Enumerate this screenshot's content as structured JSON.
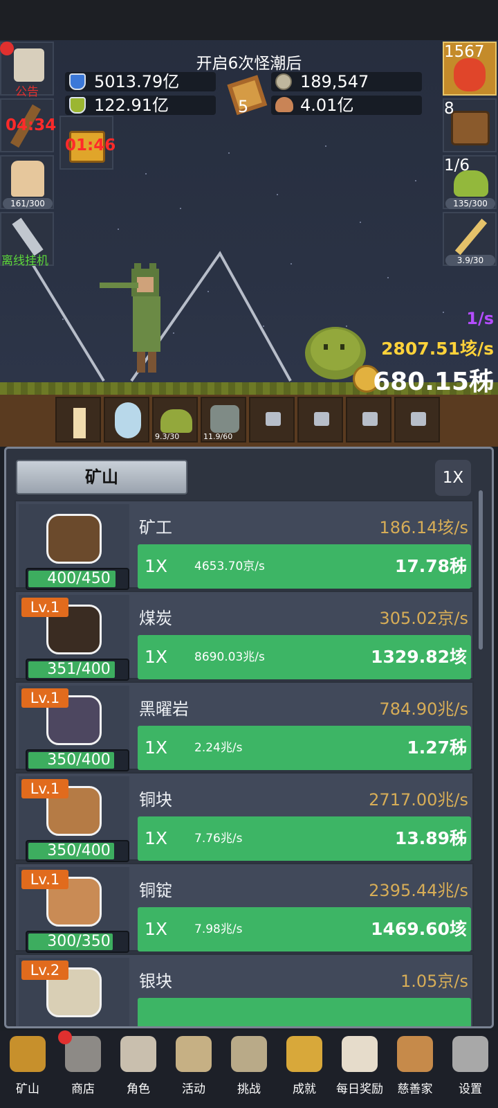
{
  "header": {
    "wave_text": "开启6次怪潮后"
  },
  "resources": {
    "blue_potion": "5013.79亿",
    "green_potion": "122.91亿",
    "book_count": "5",
    "silver": "189,547",
    "meat": "4.01亿"
  },
  "left_slots": [
    {
      "label": "公告",
      "color": "#e0302f"
    },
    {
      "label": "04:34",
      "color": "#ff2a2a"
    },
    {
      "label": "161/300",
      "color": "#ffffff"
    },
    {
      "label": "离线挂机",
      "color": "#5cd83b"
    }
  ],
  "chest_timer": "01:46",
  "right_slots": [
    {
      "label": "1567"
    },
    {
      "label": "8"
    },
    {
      "label": "1/6",
      "sub": "135/300"
    },
    {
      "label": "3.9/30"
    }
  ],
  "rates": {
    "per_s": "1/s",
    "gold_rate": "2807.51垓/s",
    "money": "680.15秭"
  },
  "units": [
    {
      "label": ""
    },
    {
      "label": ""
    },
    {
      "label": "9.3/30"
    },
    {
      "label": "11.9/60"
    },
    {
      "label": ""
    },
    {
      "label": ""
    },
    {
      "label": ""
    },
    {
      "label": ""
    }
  ],
  "mine": {
    "tab_label": "矿山",
    "multiplier": "1X",
    "rows": [
      {
        "level": "",
        "name": "矿工",
        "rate": "186.14垓/s",
        "cap": "400/450",
        "cap_ratio": 0.889,
        "mult": "1X",
        "gain": "4653.70京/s",
        "cost": "17.78秭",
        "color": "#6b4a2c"
      },
      {
        "level": "Lv.1",
        "name": "煤炭",
        "rate": "305.02京/s",
        "cap": "351/400",
        "cap_ratio": 0.878,
        "mult": "1X",
        "gain": "8690.03兆/s",
        "cost": "1329.82垓",
        "color": "#3a2c22"
      },
      {
        "level": "Lv.1",
        "name": "黑曜岩",
        "rate": "784.90兆/s",
        "cap": "350/400",
        "cap_ratio": 0.875,
        "mult": "1X",
        "gain": "2.24兆/s",
        "cost": "1.27秭",
        "color": "#4d4760"
      },
      {
        "level": "Lv.1",
        "name": "铜块",
        "rate": "2717.00兆/s",
        "cap": "350/400",
        "cap_ratio": 0.875,
        "mult": "1X",
        "gain": "7.76兆/s",
        "cost": "13.89秭",
        "color": "#b57b45"
      },
      {
        "level": "Lv.1",
        "name": "铜锭",
        "rate": "2395.44兆/s",
        "cap": "300/350",
        "cap_ratio": 0.857,
        "mult": "1X",
        "gain": "7.98兆/s",
        "cost": "1469.60垓",
        "color": "#c98b55"
      },
      {
        "level": "Lv.2",
        "name": "银块",
        "rate": "1.05京/s",
        "cap": "",
        "cap_ratio": 0,
        "mult": "",
        "gain": "",
        "cost": "",
        "color": "#d9cfb5"
      }
    ]
  },
  "nav": [
    {
      "label": "矿山",
      "icon": "lantern-icon",
      "color": "#c7902c"
    },
    {
      "label": "商店",
      "icon": "shop-stone-icon",
      "color": "#8d8a86"
    },
    {
      "label": "角色",
      "icon": "skull-icon",
      "color": "#c9bfae"
    },
    {
      "label": "活动",
      "icon": "scroll-icon",
      "color": "#c6b084"
    },
    {
      "label": "挑战",
      "icon": "map-icon",
      "color": "#b9aa88"
    },
    {
      "label": "成就",
      "icon": "key-icon",
      "color": "#d8a83a"
    },
    {
      "label": "每日奖励",
      "icon": "envelope-icon",
      "color": "#e6dccb"
    },
    {
      "label": "慈善家",
      "icon": "bread-icon",
      "color": "#c68a4a"
    },
    {
      "label": "设置",
      "icon": "gear-icon",
      "color": "#a8a8a8"
    }
  ]
}
